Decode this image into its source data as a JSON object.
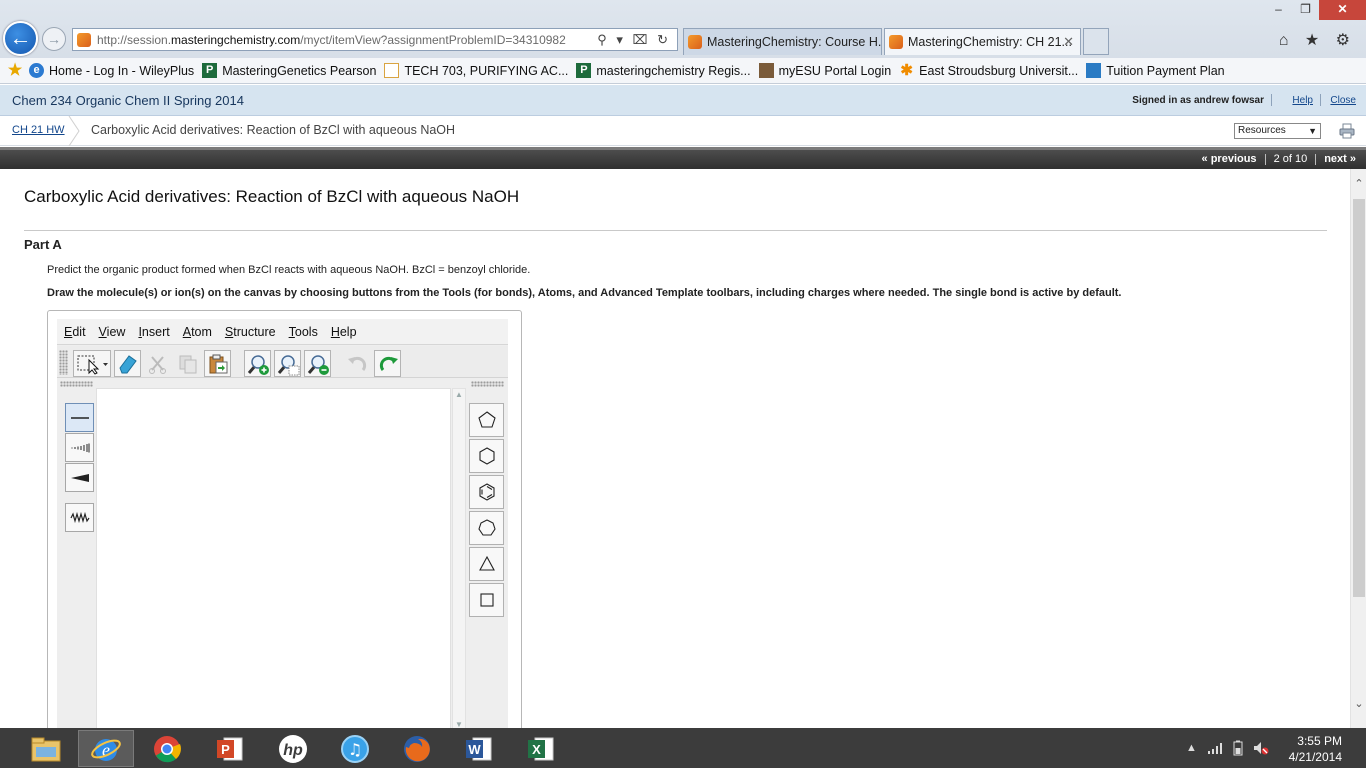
{
  "browser": {
    "url_prefix": "http://session.",
    "url_domain": "masteringchemistry.com",
    "url_suffix": "/myct/itemView?assignmentProblemID=34310982",
    "address_icons": "⚲ ▾ ⌧ ↻",
    "tabs": [
      {
        "label": "MasteringChemistry: Course H..."
      },
      {
        "label": "MasteringChemistry: CH 21...",
        "close": "✕"
      }
    ],
    "window_controls": {
      "minimize": "–",
      "restore": "❐",
      "close": "✕"
    },
    "tool_icons": "⌂ ★ ⚙",
    "favorites": [
      {
        "label": "Home - Log In - WileyPlus",
        "icon": "ie-icon"
      },
      {
        "label": "MasteringGenetics  Pearson",
        "icon": "pearson-icon",
        "glyph": "P"
      },
      {
        "label": "TECH 703, PURIFYING AC...",
        "icon": "page-icon"
      },
      {
        "label": "masteringchemistry Regis...",
        "icon": "pearson-icon",
        "glyph": "P"
      },
      {
        "label": "myESU Portal Login",
        "icon": "esu-icon"
      },
      {
        "label": "East Stroudsburg Universit...",
        "icon": "flower-icon",
        "glyph": "✱"
      },
      {
        "label": "Tuition Payment Plan",
        "icon": "tuition-icon"
      }
    ]
  },
  "site": {
    "course_title": "Chem 234 Organic Chem II Spring 2014",
    "signed_in": "Signed in as andrew fowsar",
    "help": "Help",
    "close": "Close",
    "breadcrumb_link": "CH 21 HW",
    "breadcrumb_current": "Carboxylic Acid derivatives: Reaction of BzCl with aqueous NaOH",
    "resources_selected": "Resources",
    "nav": {
      "previous": "« previous",
      "counter": "2 of 10",
      "next": "next »"
    }
  },
  "problem": {
    "title": "Carboxylic Acid derivatives: Reaction of BzCl with aqueous NaOH",
    "part": "Part A",
    "question": "Predict the organic product formed when BzCl reacts with aqueous NaOH. BzCl = benzoyl chloride.",
    "instruction": "Draw the molecule(s) or ion(s) on the canvas by choosing buttons from the Tools (for bonds), Atoms, and Advanced Template toolbars, including charges where needed. The single bond is active by default."
  },
  "sketch": {
    "menus": [
      {
        "label": "Edit",
        "key": "E",
        "rest": "dit"
      },
      {
        "label": "View",
        "key": "V",
        "rest": "iew"
      },
      {
        "label": "Insert",
        "key": "I",
        "rest": "nsert"
      },
      {
        "label": "Atom",
        "key": "A",
        "rest": "tom"
      },
      {
        "label": "Structure",
        "key": "S",
        "rest": "tructure"
      },
      {
        "label": "Tools",
        "key": "T",
        "rest": "ools"
      },
      {
        "label": "Help",
        "key": "H",
        "rest": "elp"
      }
    ],
    "active_bond": "single-bond"
  },
  "taskbar": {
    "time": "3:55 PM",
    "date": "4/21/2014",
    "tray": "▲"
  },
  "colors": {
    "course_bar": "#d6e4f0",
    "link": "#13478c",
    "nav_bar": "#3a3a3a",
    "taskbar": "#3c3c3c",
    "accent_orange": "#e8731c"
  }
}
